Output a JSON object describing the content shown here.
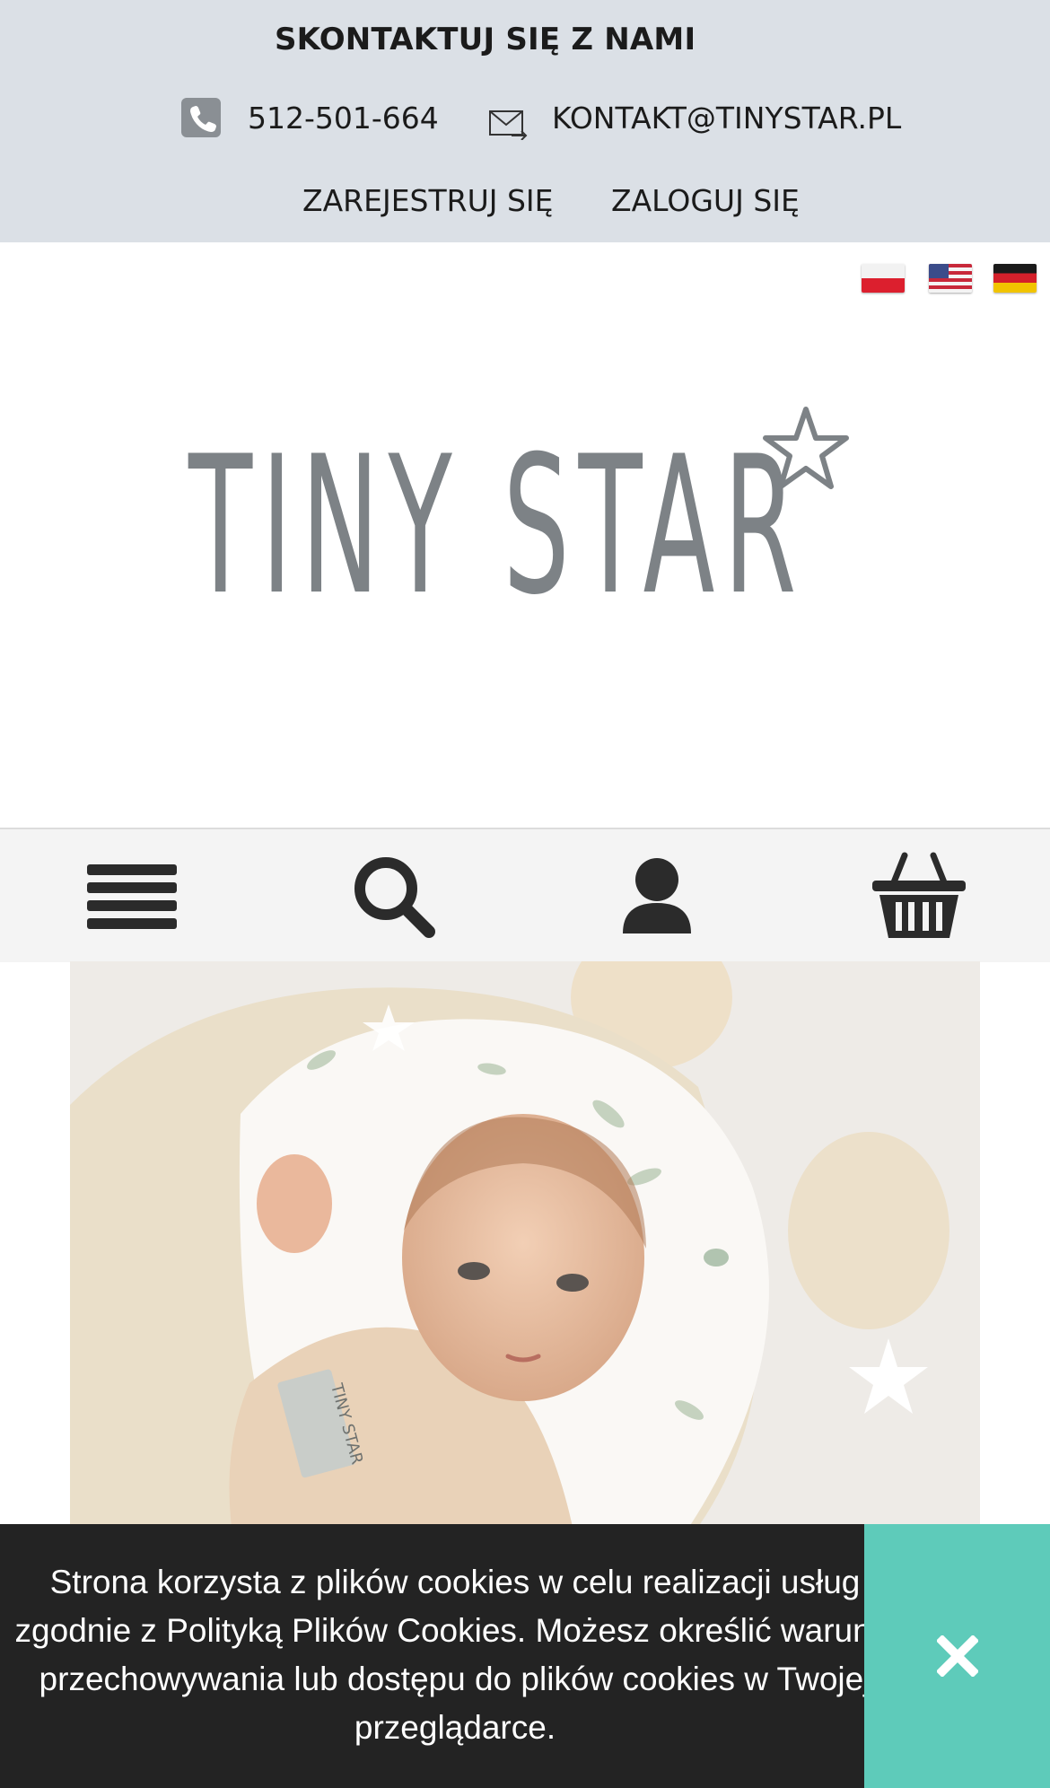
{
  "header": {
    "contact_title": "SKONTAKTUJ SIĘ Z NAMI",
    "phone": "512-501-664",
    "email": "KONTAKT@TINYSTAR.PL",
    "register": "ZAREJESTRUJ SIĘ",
    "login": "ZALOGUJ SIĘ",
    "icons": [
      "phone-icon",
      "envelope-icon"
    ]
  },
  "languages": [
    {
      "name": "polish-flag",
      "colors": [
        "#f2f2f2",
        "#dc1f2e"
      ]
    },
    {
      "name": "us-flag",
      "colors": [
        "#c8283a",
        "#f4f4f4",
        "#3b4c8a"
      ]
    },
    {
      "name": "german-flag",
      "colors": [
        "#1a1a1a",
        "#d4202b",
        "#f1c400"
      ]
    }
  ],
  "brand": {
    "logo_text": "TINY STAR",
    "logo_color": "#7d8286"
  },
  "nav": {
    "icons": [
      "menu-icon",
      "search-icon",
      "user-icon",
      "cart-icon"
    ],
    "icon_color": "#2b2b2b"
  },
  "hero": {
    "image": "baby-in-sleeping-bag-photo",
    "label_text": "TINY STAR"
  },
  "cookie_banner": {
    "text": "Strona korzysta z plików cookies w celu realizacji usług zgodnie z Polityką Plików Cookies. Możesz określić warunki przechowywania lub dostępu do plików cookies w Twojej przeglądarce.",
    "close_icon": "close-icon",
    "close_bg": "#5ecbba",
    "bg": "#232323"
  }
}
